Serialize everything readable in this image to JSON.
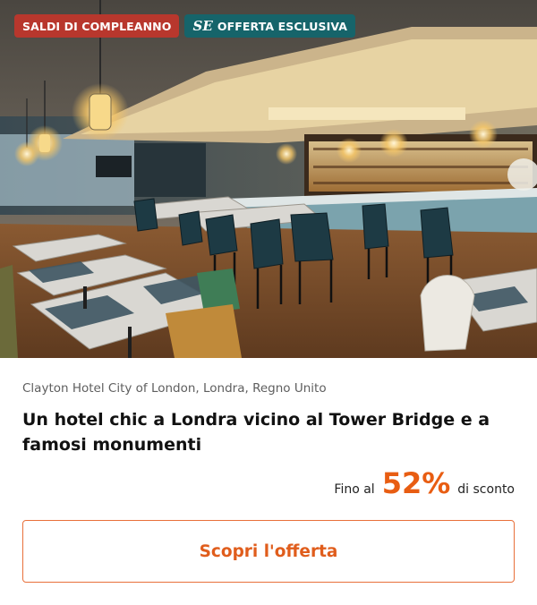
{
  "badges": {
    "birthday": "SALDI DI COMPLEANNO",
    "exclusive": "OFFERTA ESCLUSIVA",
    "exclusive_icon": "secret-escapes-logo-icon",
    "exclusive_icon_glyph": "SE"
  },
  "colors": {
    "birthday_badge": "#b8372d",
    "exclusive_badge": "#16646a",
    "accent": "#e85d12"
  },
  "hotel": {
    "location": "Clayton Hotel City of London, Londra, Regno Unito",
    "title": "Un hotel chic a Londra vicino al Tower Bridge e a famosi monumenti"
  },
  "discount": {
    "prefix": "Fino al",
    "value": "52%",
    "suffix": "di sconto"
  },
  "cta": {
    "label": "Scopri l'offerta"
  }
}
